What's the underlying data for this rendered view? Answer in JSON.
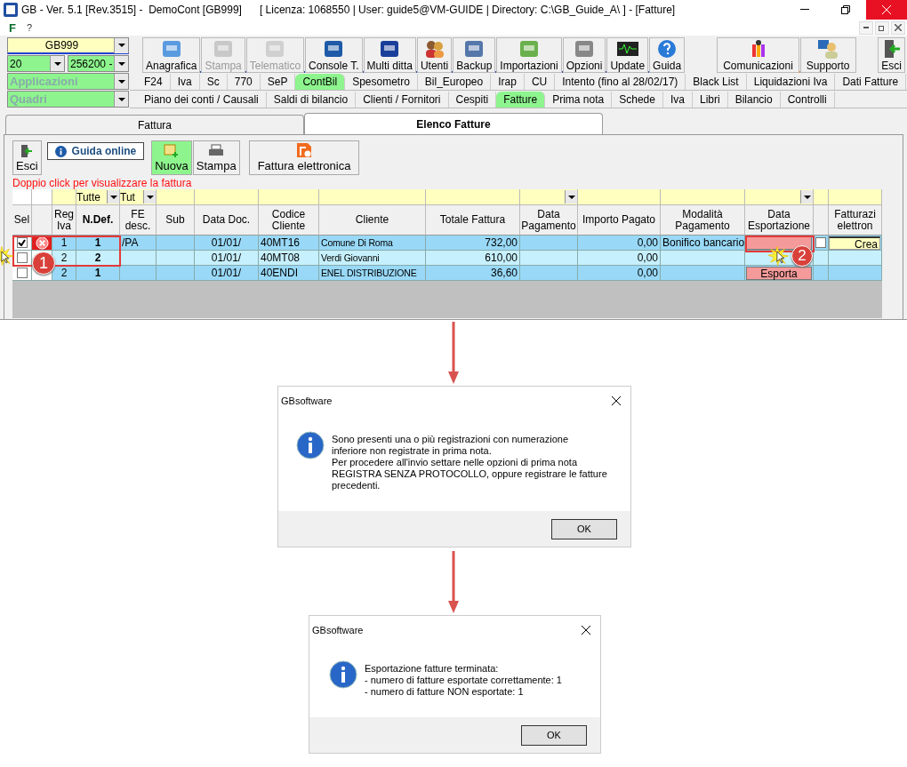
{
  "window": {
    "title": "GB - Ver. 5.1 [Rev.3515] -  DemoCont [GB999]      [ Licenza: 1068550 | User: guide5@VM-GUIDE | Directory: C:\\GB_Guide_A\\ ] - [Fatture]"
  },
  "menu": [
    "F",
    "?"
  ],
  "selectors": {
    "company": "GB999",
    "year": "20",
    "account": "256200 -",
    "applications": "Applicazioni",
    "panels": "Quadri"
  },
  "toolbar": [
    {
      "label": "Anagrafica",
      "disabled": false
    },
    {
      "label": "Stampa",
      "disabled": true
    },
    {
      "label": "Telematico",
      "disabled": true
    },
    {
      "label": "Console T.",
      "disabled": false
    },
    {
      "label": "Multi ditta",
      "disabled": false
    },
    {
      "label": "Utenti",
      "disabled": false
    },
    {
      "label": "Backup",
      "disabled": false
    },
    {
      "label": "Importazioni",
      "disabled": false
    },
    {
      "label": "Opzioni",
      "disabled": false
    },
    {
      "label": "Update",
      "disabled": false
    },
    {
      "label": "Guida",
      "disabled": false
    }
  ],
  "toolbar_right": [
    {
      "label": "Comunicazioni"
    },
    {
      "label": "Supporto"
    }
  ],
  "exit_button": "Esci",
  "module_tabs": [
    {
      "label": "F24",
      "selected": false
    },
    {
      "label": "Iva",
      "selected": false
    },
    {
      "label": "Sc",
      "selected": false
    },
    {
      "label": "770",
      "selected": false
    },
    {
      "label": "SeP",
      "selected": false
    },
    {
      "label": "ContBil",
      "selected": true
    },
    {
      "label": "Spesometro",
      "selected": false
    },
    {
      "label": "Bil_Europeo",
      "selected": false
    },
    {
      "label": "Irap",
      "selected": false
    },
    {
      "label": "CU",
      "selected": false
    },
    {
      "label": "Intento (fino al 28/02/17)",
      "selected": false
    },
    {
      "label": "Black List",
      "selected": false
    },
    {
      "label": "Liquidazioni Iva",
      "selected": false
    },
    {
      "label": "Dati Fatture",
      "selected": false
    }
  ],
  "section_tabs": [
    {
      "label": "Piano dei conti / Causali",
      "selected": false
    },
    {
      "label": "Saldi di bilancio",
      "selected": false
    },
    {
      "label": "Clienti / Fornitori",
      "selected": false
    },
    {
      "label": "Cespiti",
      "selected": false
    },
    {
      "label": "Fatture",
      "selected": true
    },
    {
      "label": "Prima nota",
      "selected": false
    },
    {
      "label": "Schede",
      "selected": false
    },
    {
      "label": "Iva",
      "selected": false
    },
    {
      "label": "Libri",
      "selected": false
    },
    {
      "label": "Bilancio",
      "selected": false
    },
    {
      "label": "Controlli",
      "selected": false
    }
  ],
  "page_tabs": [
    {
      "label": "Fattura",
      "selected": false
    },
    {
      "label": "Elenco Fatture",
      "selected": true
    }
  ],
  "actions": {
    "exit": "Esci",
    "help": "Guida online",
    "new": "Nuova",
    "print": "Stampa",
    "e_invoice": "Fattura elettronica"
  },
  "hint": "Doppio click per visualizzare la fattura",
  "table": {
    "columns": [
      {
        "label": "Sel"
      },
      {
        "label": "Reg\nIva"
      },
      {
        "label": "N.Def.",
        "filter": "Tutte"
      },
      {
        "label": "FE\ndesc.",
        "filter": "Tut"
      },
      {
        "label": "Sub"
      },
      {
        "label": "Data Doc."
      },
      {
        "label": "Codice\nCliente"
      },
      {
        "label": "Cliente"
      },
      {
        "label": "Totale Fattura"
      },
      {
        "label": "Data\nPagamento",
        "dropdown": true
      },
      {
        "label": "Importo Pagato"
      },
      {
        "label": "Modalità\nPagamento"
      },
      {
        "label": "Data\nEsportazione",
        "dropdown": true
      },
      {
        "label": "Fatturazi\nelettron"
      }
    ],
    "rows": [
      {
        "checked": true,
        "error": true,
        "reg_iva": "1",
        "n_def": "1",
        "fe_desc": "/PA",
        "data_doc": "01/01/",
        "codice": "40MT16",
        "cliente": "Comune Di Roma",
        "totale": "732,00",
        "importo": "0,00",
        "modalita": "Bonifico bancario",
        "export": {
          "kind": "button"
        },
        "e_invoice": {
          "checked": false,
          "action": "Crea"
        }
      },
      {
        "checked": false,
        "error": false,
        "reg_iva": "2",
        "n_def": "2",
        "data_doc": "01/01/",
        "codice": "40MT08",
        "cliente": "Verdi Giovanni",
        "totale": "610,00",
        "importo": "0,00"
      },
      {
        "checked": false,
        "error": false,
        "reg_iva": "2",
        "n_def": "1",
        "data_doc": "01/01/",
        "codice": "40ENDI",
        "cliente": "ENEL DISTRIBUZIONE",
        "totale": "36,60",
        "importo": "0,00",
        "export": {
          "kind": "button",
          "label": "Esporta"
        }
      }
    ]
  },
  "callouts": [
    "1",
    "2"
  ],
  "dialogs": [
    {
      "title": "GBsoftware",
      "message": "Sono presenti una o più registrazioni con numerazione\ninferiore non registrate in prima nota.\nPer procedere all'invio settare nelle opzioni di prima nota\nREGISTRA SENZA PROTOCOLLO, oppure registrare le fatture\nprecedenti.",
      "button": "OK"
    },
    {
      "title": "GBsoftware",
      "message": "Esportazione fatture terminata:\n- numero di fatture esportate correttamente: 1\n- numero di fatture NON esportate: 1",
      "button": "OK"
    }
  ]
}
